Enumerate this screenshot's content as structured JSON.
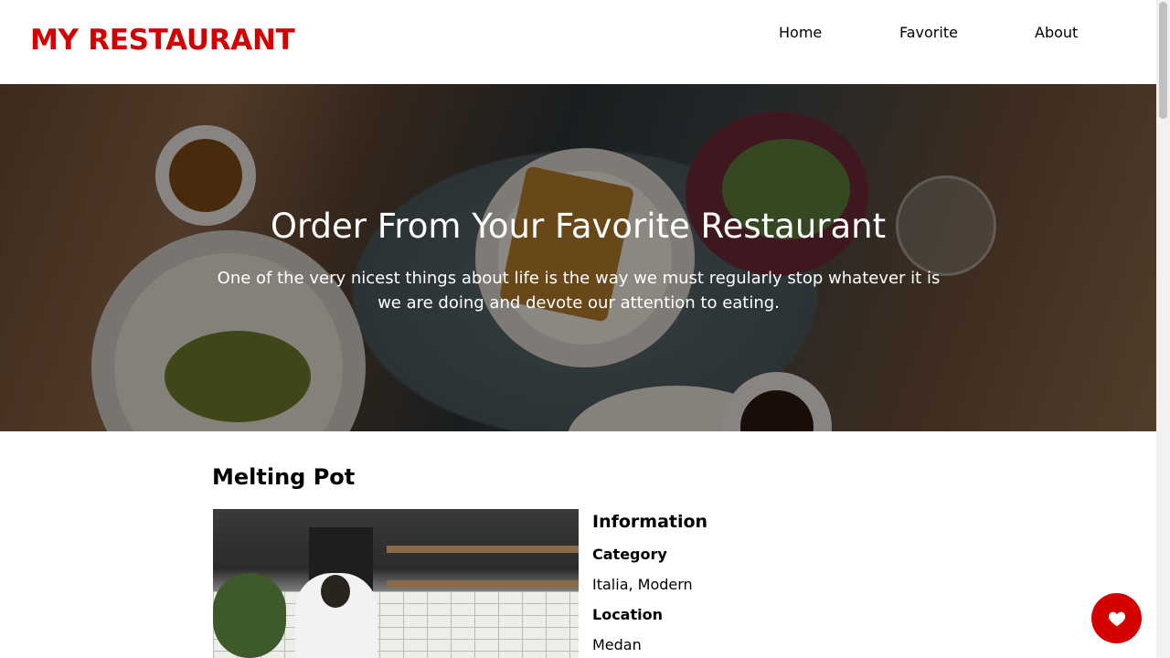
{
  "header": {
    "brand": "MY RESTAURANT",
    "nav": [
      {
        "label": "Home"
      },
      {
        "label": "Favorite"
      },
      {
        "label": "About"
      }
    ]
  },
  "hero": {
    "title": "Order From Your Favorite Restaurant",
    "subtitle": "One of the very nicest things about life is the way we must regularly stop whatever it is we are doing and devote our attention to eating."
  },
  "restaurant": {
    "name": "Melting Pot",
    "info_heading": "Information",
    "category_label": "Category",
    "category_value": "Italia, Modern",
    "location_label": "Location",
    "location_value": "Medan"
  },
  "fab": {
    "icon": "heart-icon"
  },
  "colors": {
    "brand": "#d40000",
    "fab": "#d40000"
  }
}
